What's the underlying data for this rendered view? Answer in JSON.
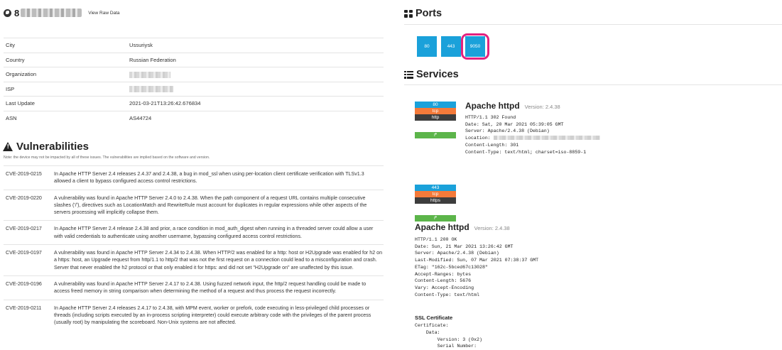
{
  "host": {
    "ip_prefix": "8",
    "view_raw_label": "View Raw Data"
  },
  "info": {
    "rows": [
      {
        "key": "City",
        "value": "Ussuriysk"
      },
      {
        "key": "Country",
        "value": "Russian Federation"
      },
      {
        "key": "Organization",
        "value": ""
      },
      {
        "key": "ISP",
        "value": ""
      },
      {
        "key": "Last Update",
        "value": "2021-03-21T13:26:42.676834"
      },
      {
        "key": "ASN",
        "value": "AS44724"
      }
    ]
  },
  "vulnerabilities": {
    "title": "Vulnerabilities",
    "note": "Note: the device may not be impacted by all of these issues. The vulnerabilities are implied based on the software and version.",
    "items": [
      {
        "cve": "CVE-2019-0215",
        "description": "In Apache HTTP Server 2.4 releases 2.4.37 and 2.4.38, a bug in mod_ssl when using per-location client certificate verification with TLSv1.3 allowed a client to bypass configured access control restrictions."
      },
      {
        "cve": "CVE-2019-0220",
        "description": "A vulnerability was found in Apache HTTP Server 2.4.0 to 2.4.38. When the path component of a request URL contains multiple consecutive slashes ('/'), directives such as LocationMatch and RewriteRule must account for duplicates in regular expressions while other aspects of the servers processing will implicitly collapse them."
      },
      {
        "cve": "CVE-2019-0217",
        "description": "In Apache HTTP Server 2.4 release 2.4.38 and prior, a race condition in mod_auth_digest when running in a threaded server could allow a user with valid credentials to authenticate using another username, bypassing configured access control restrictions."
      },
      {
        "cve": "CVE-2019-0197",
        "description": "A vulnerability was found in Apache HTTP Server 2.4.34 to 2.4.38. When HTTP/2 was enabled for a http: host or H2Upgrade was enabled for h2 on a https: host, an Upgrade request from http/1.1 to http/2 that was not the first request on a connection could lead to a misconfiguration and crash. Server that never enabled the h2 protocol or that only enabled it for https: and did not set \"H2Upgrade on\" are unaffected by this issue."
      },
      {
        "cve": "CVE-2019-0196",
        "description": "A vulnerability was found in Apache HTTP Server 2.4.17 to 2.4.38. Using fuzzed network input, the http/2 request handling could be made to access freed memory in string comparison when determining the method of a request and thus process the request incorrectly."
      },
      {
        "cve": "CVE-2019-0211",
        "description": "In Apache HTTP Server 2.4 releases 2.4.17 to 2.4.38, with MPM event, worker or prefork, code executing in less-privileged child processes or threads (including scripts executed by an in-process scripting interpreter) could execute arbitrary code with the privileges of the parent process (usually root) by manipulating the scoreboard. Non-Unix systems are not affected."
      }
    ]
  },
  "ports": {
    "title": "Ports",
    "list": [
      "80",
      "443",
      "9050"
    ],
    "highlighted": "9050",
    "highlight_color": "#e3227f",
    "port_color": "#1aa1da"
  },
  "services": {
    "title": "Services",
    "items": [
      {
        "port": "80",
        "transport": "tcp",
        "protocol": "http",
        "link_icon": "↱",
        "product": "Apache httpd",
        "version": "Version: 2.4.38",
        "banner_lines": [
          "HTTP/1.1 302 Found",
          "Date: Sat, 20 Mar 2021 05:39:05 GMT",
          "Server: Apache/2.4.38 (Debian)",
          "Location: ",
          "Content-Length: 301",
          "Content-Type: text/html; charset=iso-8859-1"
        ]
      },
      {
        "port": "443",
        "transport": "tcp",
        "protocol": "https",
        "link_icon": "↱",
        "product": "Apache httpd",
        "version": "Version: 2.4.38",
        "banner_lines": [
          "HTTP/1.1 200 OK",
          "Date: Sun, 21 Mar 2021 13:26:42 GMT",
          "Server: Apache/2.4.38 (Debian)",
          "Last-Modified: Sun, 07 Mar 2021 07:38:37 GMT",
          "ETag: \"162c-5bced67c13028\"",
          "Accept-Ranges: bytes",
          "Content-Length: 5676",
          "Vary: Accept-Encoding",
          "Content-Type: text/html"
        ]
      }
    ]
  },
  "ssl": {
    "heading": "SSL Certificate",
    "lines": [
      "Certificate:",
      "    Data:",
      "        Version: 3 (0x2)",
      "        Serial Number:"
    ]
  },
  "colors": {
    "tcp": "#f47a3a",
    "proto": "#3d3d3d",
    "link": "#5cb54a",
    "port": "#1aa1da"
  }
}
